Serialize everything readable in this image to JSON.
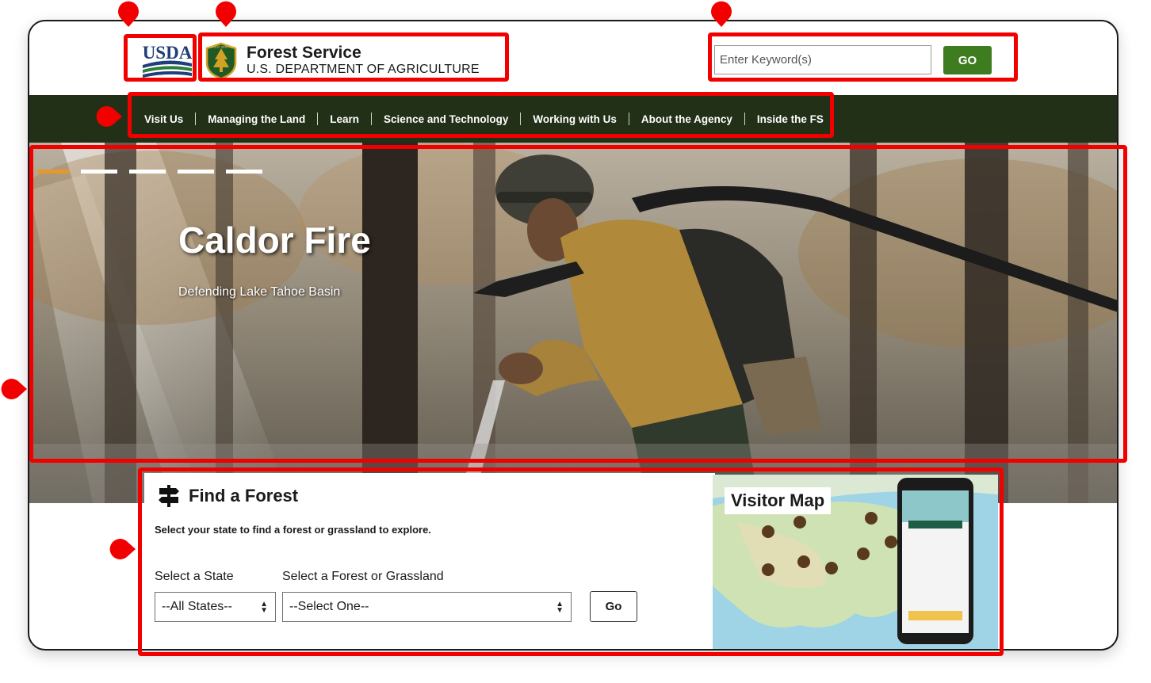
{
  "header": {
    "usda_logo_text": "USDA",
    "agency_name": "Forest Service",
    "agency_subtitle": "U.S. DEPARTMENT OF AGRICULTURE",
    "shield_text": "FOREST SERVICE",
    "search_placeholder": "Enter Keyword(s)",
    "search_button": "GO"
  },
  "nav": {
    "items": [
      "Visit Us",
      "Managing the Land",
      "Learn",
      "Science and Technology",
      "Working with Us",
      "About the Agency",
      "Inside the FS"
    ]
  },
  "hero": {
    "title": "Caldor Fire",
    "subtitle": "Defending Lake Tahoe Basin",
    "slide_count": 5,
    "active_slide": 1
  },
  "find_forest": {
    "title": "Find a Forest",
    "description": "Select your state to find a forest or grassland to explore.",
    "state_label": "Select a State",
    "state_value": "--All States--",
    "forest_label": "Select a Forest or Grassland",
    "forest_value": "--Select One--",
    "go_button": "Go"
  },
  "visitor_map": {
    "label": "Visitor Map"
  },
  "colors": {
    "nav_bg": "#213016",
    "go_green": "#3e7d1f",
    "annotation_red": "#f20000",
    "slide_active": "#e39a2c"
  }
}
